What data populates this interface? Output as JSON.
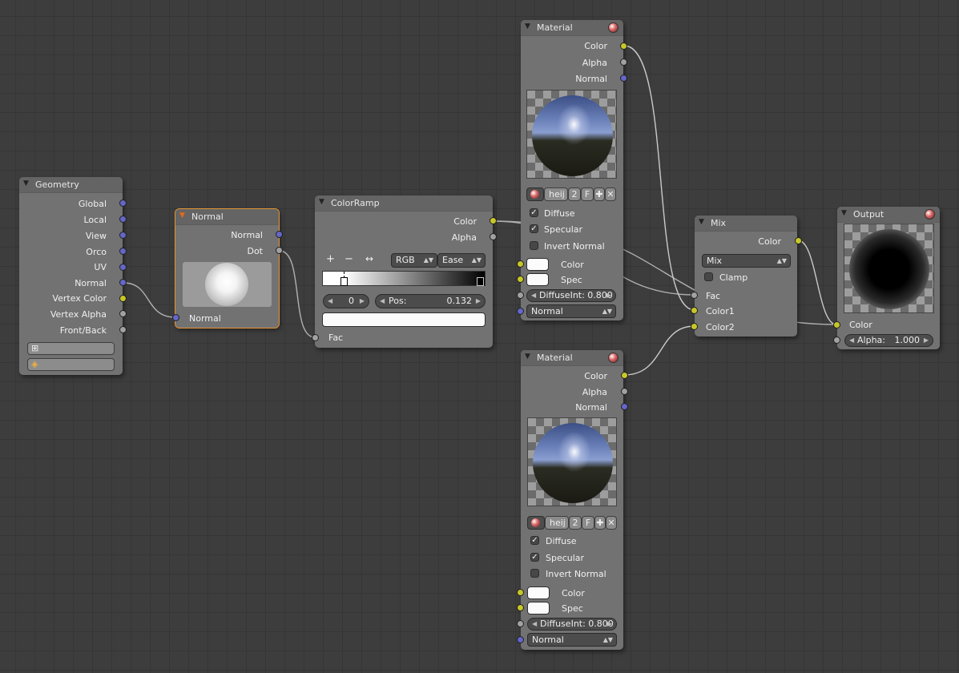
{
  "colors": {
    "socket_vector": "#6466c8",
    "socket_color": "#c7c729",
    "socket_value": "#a1a1a1",
    "node_body": "#727272",
    "active_outline": "#e89433"
  },
  "geometry": {
    "title": "Geometry",
    "outputs": [
      "Global",
      "Local",
      "View",
      "Orco",
      "UV",
      "Normal",
      "Vertex Color",
      "Vertex Alpha",
      "Front/Back"
    ]
  },
  "normal_node": {
    "title": "Normal",
    "outputs": [
      "Normal",
      "Dot"
    ],
    "input": "Normal"
  },
  "colorramp": {
    "title": "ColorRamp",
    "outputs": [
      "Color",
      "Alpha"
    ],
    "add_label": "+",
    "remove_label": "−",
    "flip_label": "↔",
    "color_mode": "RGB",
    "interpolation": "Ease",
    "active_index": "0",
    "pos_label": "Pos:",
    "pos_value": "0.132",
    "input": "Fac"
  },
  "material_top": {
    "title": "Material",
    "outputs": [
      "Color",
      "Alpha",
      "Normal"
    ],
    "mat_name": "heij",
    "users": "2",
    "fake_user": "F",
    "checks": [
      {
        "label": "Diffuse",
        "checked": true
      },
      {
        "label": "Specular",
        "checked": true
      },
      {
        "label": "Invert Normal",
        "checked": false
      }
    ],
    "color_label": "Color",
    "spec_label": "Spec",
    "diffuse_int": "DiffuseInt: 0.800",
    "normal_label": "Normal"
  },
  "material_bottom": {
    "title": "Material",
    "outputs": [
      "Color",
      "Alpha",
      "Normal"
    ],
    "mat_name": "heij",
    "users": "2",
    "fake_user": "F",
    "checks": [
      {
        "label": "Diffuse",
        "checked": true
      },
      {
        "label": "Specular",
        "checked": true
      },
      {
        "label": "Invert Normal",
        "checked": false
      }
    ],
    "color_label": "Color",
    "spec_label": "Spec",
    "diffuse_int": "DiffuseInt: 0.800",
    "normal_label": "Normal"
  },
  "mix": {
    "title": "Mix",
    "output": "Color",
    "blend_type": "Mix",
    "clamp_label": "Clamp",
    "clamp_checked": false,
    "inputs": [
      "Fac",
      "Color1",
      "Color2"
    ]
  },
  "output_node": {
    "title": "Output",
    "input_color": "Color",
    "alpha_label": "Alpha:",
    "alpha_value": "1.000"
  },
  "icons": [
    "collapse-triangle-icon",
    "material-ball-icon",
    "uv-map-icon",
    "vertex-color-icon",
    "add-icon",
    "remove-icon",
    "flip-icon",
    "close-icon",
    "fake-user-icon"
  ]
}
